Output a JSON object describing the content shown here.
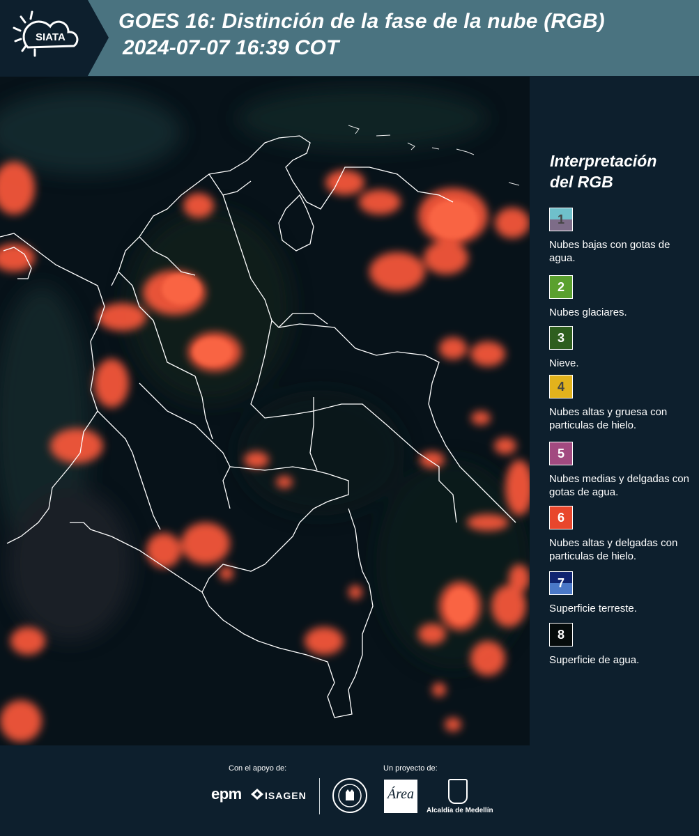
{
  "header": {
    "logo_text": "SIATA",
    "title_line1": "GOES 16: Distinción de la fase de la nube (RGB)",
    "title_line2": "2024-07-07 16:39 COT"
  },
  "legend": {
    "title_line1": "Interpretación",
    "title_line2": "del RGB",
    "items": [
      {
        "num": "1",
        "desc": "Nubes bajas con gotas de agua.",
        "color_top": "#6fc0cb",
        "color_bottom": "#7d6c88",
        "num_color": "#444444"
      },
      {
        "num": "2",
        "desc": "Nubes glaciares.",
        "color": "#5aa02e",
        "num_color": "#ffffff"
      },
      {
        "num": "3",
        "desc": "Nieve.",
        "color": "#2e5e1e",
        "num_color": "#ffffff"
      },
      {
        "num": "4",
        "desc": "Nubes altas y gruesa con particulas de hielo.",
        "color": "#e2b21c",
        "num_color": "#444444"
      },
      {
        "num": "5",
        "desc": "Nubes medias y delgadas con gotas de agua.",
        "color": "#a24a80",
        "num_color": "#ffffff"
      },
      {
        "num": "6",
        "desc": "Nubes altas y delgadas con particulas de hielo.",
        "color": "#e8462c",
        "num_color": "#ffffff"
      },
      {
        "num": "7",
        "desc": "Superficie terreste.",
        "color_top": "#0f2470",
        "color_bottom": "#4a78c8",
        "num_color": "#ffffff"
      },
      {
        "num": "8",
        "desc": "Superficie de agua.",
        "color": "#050b0b",
        "num_color": "#ffffff"
      }
    ]
  },
  "footer": {
    "support_label": "Con el apoyo de:",
    "project_label": "Un proyecto de:",
    "sponsor1": "epm",
    "sponsor2": "ISAGEN",
    "area_text": "Área",
    "alcaldia": "Alcaldía de Medellín"
  },
  "colors": {
    "header_bg": "#4a7380",
    "logo_bg": "#0d1f2d",
    "panel_bg": "#0d1f2d",
    "cloud": "#ff5a3a"
  }
}
